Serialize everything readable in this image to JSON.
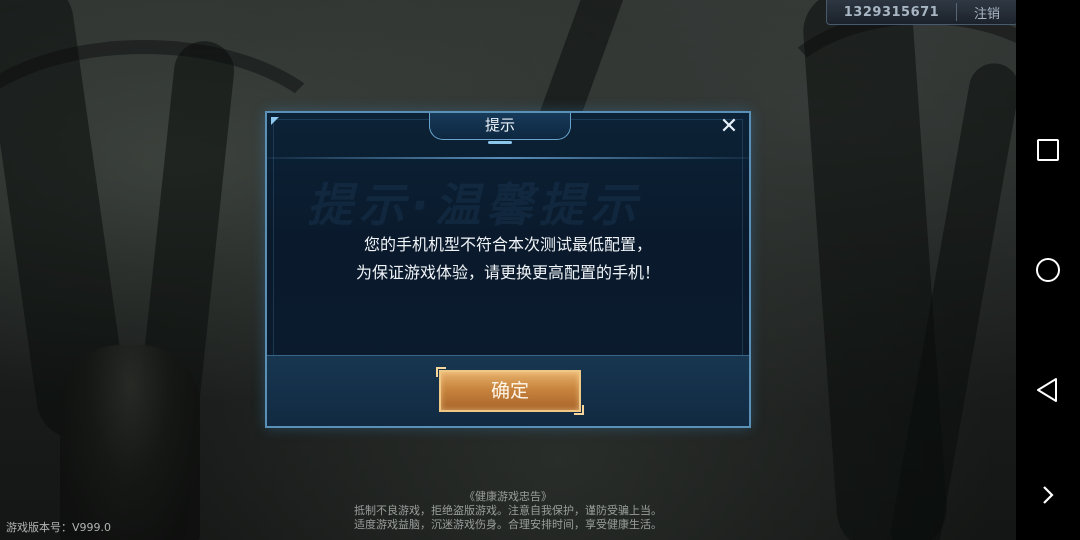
{
  "account_bar": {
    "account_id": "1329315671",
    "logout_label": "注销"
  },
  "dialog": {
    "title": "提示",
    "close_icon": "close-icon",
    "watermark": "提示·温馨提示",
    "message_line1": "您的手机机型不符合本次测试最低配置，",
    "message_line2": "为保证游戏体验，请更换更高配置的手机！",
    "confirm_label": "确定"
  },
  "footer": {
    "version": "游戏版本号：V999.0",
    "health_title": "《健康游戏忠告》",
    "health_line1": "抵制不良游戏，拒绝盗版游戏。注意自我保护，谨防受骗上当。",
    "health_line2": "适度游戏益脑，沉迷游戏伤身。合理安排时间，享受健康生活。"
  },
  "navbar": {
    "icons": [
      "recent-apps-icon",
      "home-icon",
      "back-icon",
      "more-icon"
    ]
  },
  "colors": {
    "dialog_border": "#5a8fb6",
    "confirm_button": "#c8843e"
  }
}
